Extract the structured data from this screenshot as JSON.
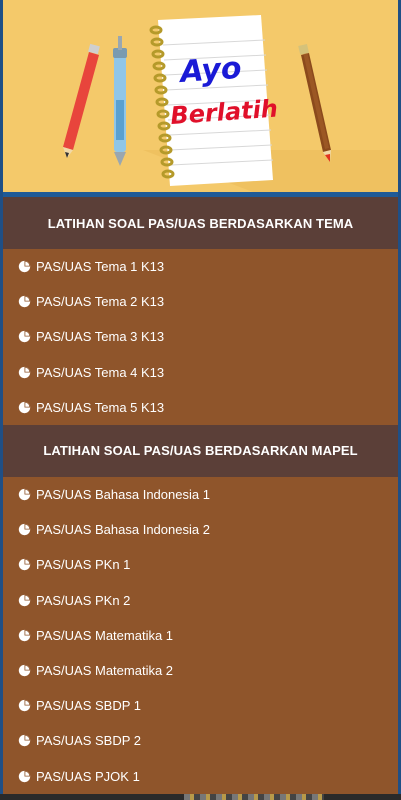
{
  "banner": {
    "title_line1": "Ayo",
    "title_line2": "Berlatih"
  },
  "sections": [
    {
      "header": "LATIHAN SOAL PAS/UAS BERDASARKAN TEMA",
      "items": [
        "PAS/UAS Tema 1 K13",
        "PAS/UAS Tema 2 K13",
        "PAS/UAS Tema 3 K13",
        "PAS/UAS Tema 4 K13",
        "PAS/UAS Tema 5 K13"
      ]
    },
    {
      "header": "LATIHAN SOAL PAS/UAS BERDASARKAN MAPEL",
      "items": [
        "PAS/UAS Bahasa Indonesia 1",
        "PAS/UAS Bahasa Indonesia 2",
        "PAS/UAS PKn 1",
        "PAS/UAS PKn 2",
        "PAS/UAS Matematika 1",
        "PAS/UAS Matematika 2",
        "PAS/UAS SBDP 1",
        "PAS/UAS SBDP 2",
        "PAS/UAS PJOK 1"
      ]
    }
  ],
  "item_icon": "pie-chart-icon",
  "colors": {
    "banner_bg": "#f4c96a",
    "header_bg": "#5b3f38",
    "panel_bg": "#8f552b",
    "frame": "#1f5a97",
    "title_ayo": "#1a1ad6",
    "title_berlatih": "#e0102a"
  }
}
